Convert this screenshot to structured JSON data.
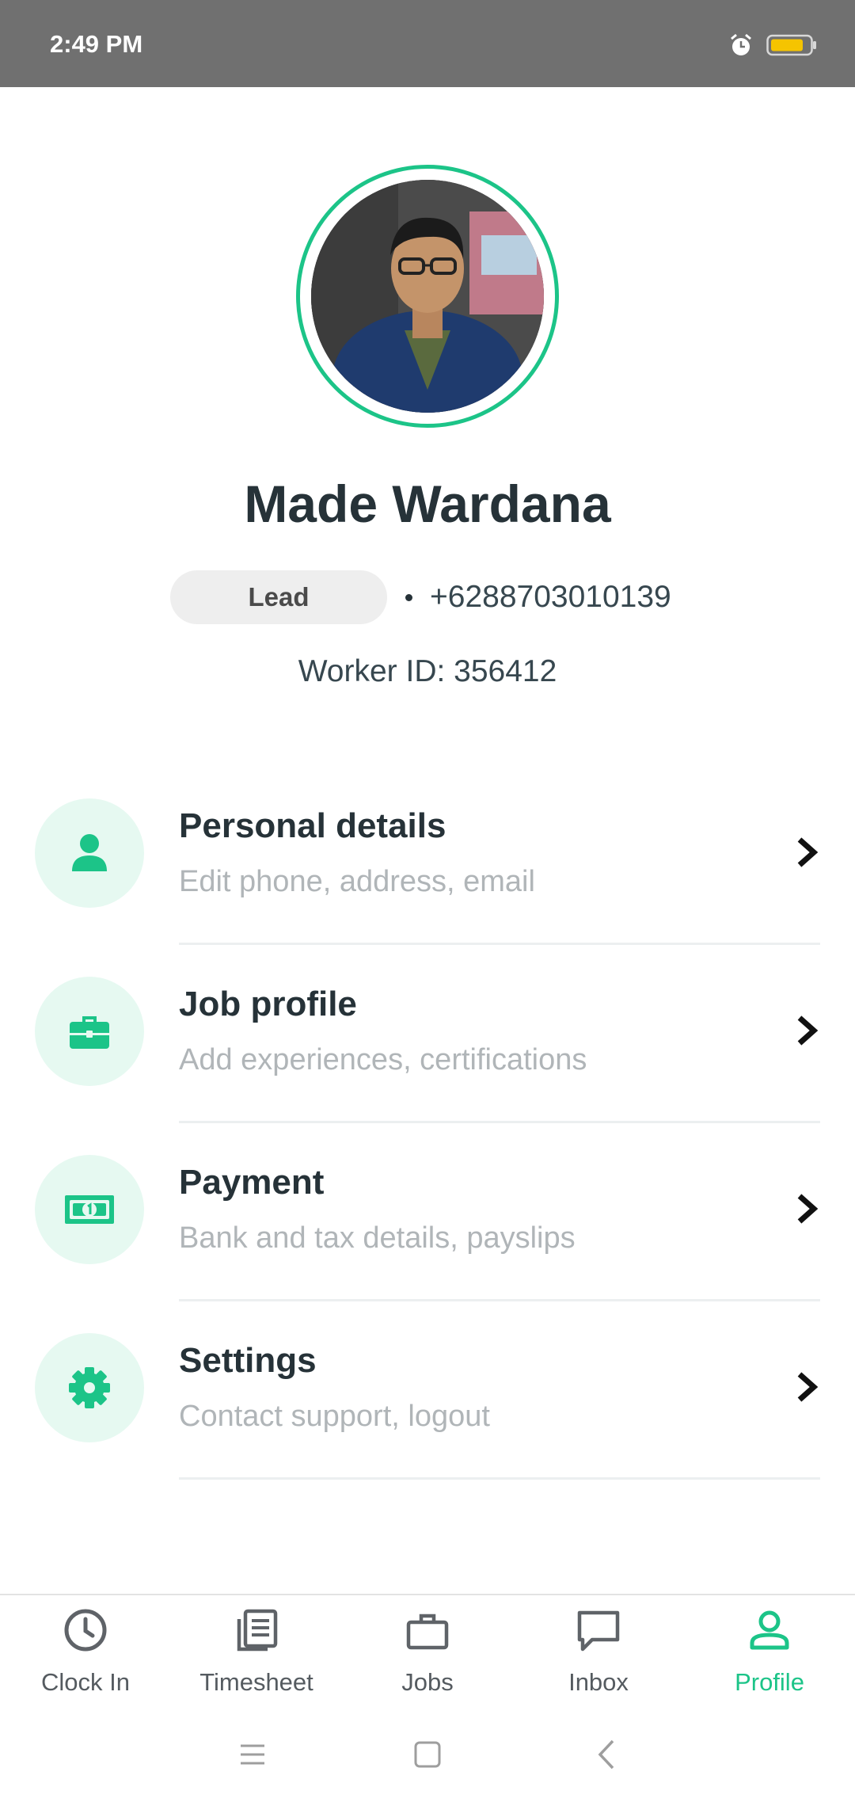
{
  "status_bar": {
    "time": "2:49 PM"
  },
  "profile": {
    "name": "Made Wardana",
    "role": "Lead",
    "phone": "+6288703010139",
    "worker_id": "Worker ID: 356412"
  },
  "menu": [
    {
      "title": "Personal details",
      "subtitle": "Edit phone, address, email",
      "icon": "person-icon"
    },
    {
      "title": "Job profile",
      "subtitle": "Add experiences, certifications",
      "icon": "briefcase-icon"
    },
    {
      "title": "Payment",
      "subtitle": "Bank and tax details, payslips",
      "icon": "banknote-icon"
    },
    {
      "title": "Settings",
      "subtitle": "Contact support, logout",
      "icon": "gear-icon"
    }
  ],
  "bottom_nav": [
    {
      "label": "Clock In",
      "icon": "clock-icon",
      "active": false
    },
    {
      "label": "Timesheet",
      "icon": "document-icon",
      "active": false
    },
    {
      "label": "Jobs",
      "icon": "briefcase-icon",
      "active": false
    },
    {
      "label": "Inbox",
      "icon": "chat-icon",
      "active": false
    },
    {
      "label": "Profile",
      "icon": "person-icon",
      "active": true
    }
  ],
  "colors": {
    "accent": "#1cc488",
    "icon_bg": "#e6f9f1",
    "status_bar": "#707070",
    "battery": "#f5c400"
  }
}
